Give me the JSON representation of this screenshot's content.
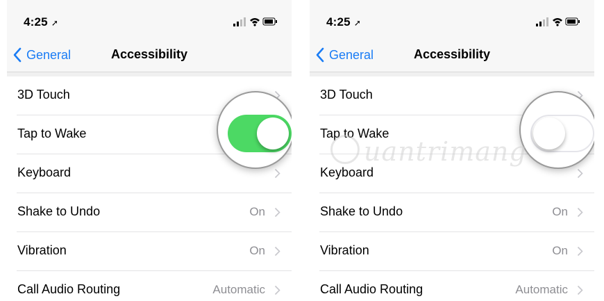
{
  "panels": [
    {
      "status": {
        "time": "4:25",
        "location_icon": "location-arrow-icon",
        "signal_icon": "signal-bars-icon",
        "wifi_icon": "wifi-icon",
        "battery_icon": "battery-icon"
      },
      "nav": {
        "back_label": "General",
        "title": "Accessibility"
      },
      "rows": [
        {
          "label": "3D Touch",
          "value": ""
        },
        {
          "label": "Tap to Wake",
          "value": ""
        },
        {
          "label": "Keyboard",
          "value": ""
        },
        {
          "label": "Shake to Undo",
          "value": "On"
        },
        {
          "label": "Vibration",
          "value": "On"
        },
        {
          "label": "Call Audio Routing",
          "value": "Automatic"
        }
      ],
      "toggle": {
        "target": "Tap to Wake",
        "state": "on",
        "color": "#4cd964"
      }
    },
    {
      "status": {
        "time": "4:25",
        "location_icon": "location-arrow-icon",
        "signal_icon": "signal-bars-icon",
        "wifi_icon": "wifi-icon",
        "battery_icon": "battery-icon"
      },
      "nav": {
        "back_label": "General",
        "title": "Accessibility"
      },
      "rows": [
        {
          "label": "3D Touch",
          "value": ""
        },
        {
          "label": "Tap to Wake",
          "value": ""
        },
        {
          "label": "Keyboard",
          "value": ""
        },
        {
          "label": "Shake to Undo",
          "value": "On"
        },
        {
          "label": "Vibration",
          "value": "On"
        },
        {
          "label": "Call Audio Routing",
          "value": "Automatic"
        }
      ],
      "toggle": {
        "target": "Tap to Wake",
        "state": "off",
        "color": "#ffffff"
      }
    }
  ],
  "watermark": {
    "text": "uantrimang"
  },
  "colors": {
    "accent": "#1a7cf5",
    "toggle_on": "#4cd964",
    "secondary_text": "#8e8e93"
  }
}
